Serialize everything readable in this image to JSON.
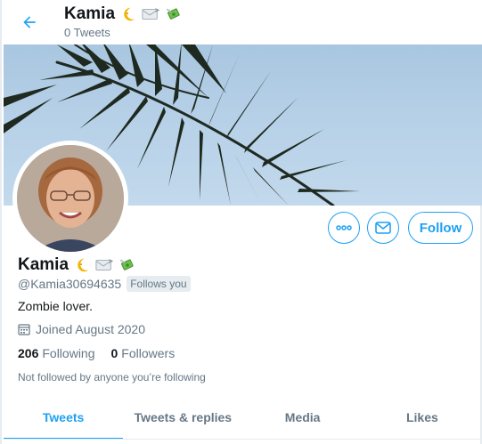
{
  "header": {
    "name": "Kamia",
    "tweet_count": "0 Tweets"
  },
  "profile": {
    "name": "Kamia",
    "handle": "@Kamia30694635",
    "follows_you": "Follows you",
    "bio": "Zombie lover.",
    "joined": "Joined August 2020",
    "following_count": "206",
    "following_label": "Following",
    "followers_count": "0",
    "followers_label": "Followers",
    "not_followed_text": "Not followed by anyone you’re following",
    "name_emojis": [
      "crescent-moon",
      "envelope",
      "money-with-wings"
    ]
  },
  "actions": {
    "follow_label": "Follow",
    "more_icon": "more-icon",
    "message_icon": "envelope-icon"
  },
  "tabs": [
    {
      "label": "Tweets",
      "active": true
    },
    {
      "label": "Tweets & replies",
      "active": false
    },
    {
      "label": "Media",
      "active": false
    },
    {
      "label": "Likes",
      "active": false
    }
  ],
  "colors": {
    "accent": "#1da1f2",
    "muted": "#657786",
    "text": "#14171a",
    "border": "#e6ecf0"
  }
}
